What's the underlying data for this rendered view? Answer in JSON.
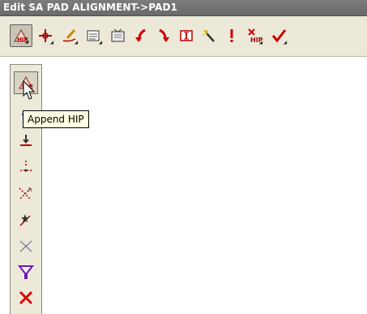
{
  "window": {
    "title": "Edit SA PAD ALIGNMENT->PAD1"
  },
  "toolbar": {
    "items": [
      {
        "icon": "hip-edit-icon",
        "pressed": true
      },
      {
        "icon": "move-cross-icon"
      },
      {
        "icon": "pencil-curve-icon"
      },
      {
        "icon": "list-edit-icon"
      },
      {
        "icon": "tv-screen-icon"
      },
      {
        "icon": "arrow-curve-left-icon"
      },
      {
        "icon": "arrow-curve-right-icon"
      },
      {
        "icon": "i-beam-icon"
      },
      {
        "icon": "wand-icon"
      },
      {
        "icon": "exclamation-icon"
      },
      {
        "icon": "delete-hip-icon"
      },
      {
        "icon": "checkmark-icon"
      }
    ]
  },
  "side_panel": {
    "tooltip": "Append HIP",
    "items": [
      {
        "icon": "append-hip-icon",
        "pressed": true
      },
      {
        "icon": "hidden-icon"
      },
      {
        "icon": "insert-down-icon"
      },
      {
        "icon": "split-point-icon"
      },
      {
        "icon": "intersect-icon"
      },
      {
        "icon": "star-line-icon"
      },
      {
        "icon": "cross-line-icon"
      },
      {
        "icon": "filter-icon"
      },
      {
        "icon": "delete-x-icon"
      }
    ]
  },
  "colors": {
    "title_bg": "#737373",
    "toolbar_bg": "#ece9d8",
    "tooltip_bg": "#ffffe1",
    "accent_red": "#c00000"
  }
}
